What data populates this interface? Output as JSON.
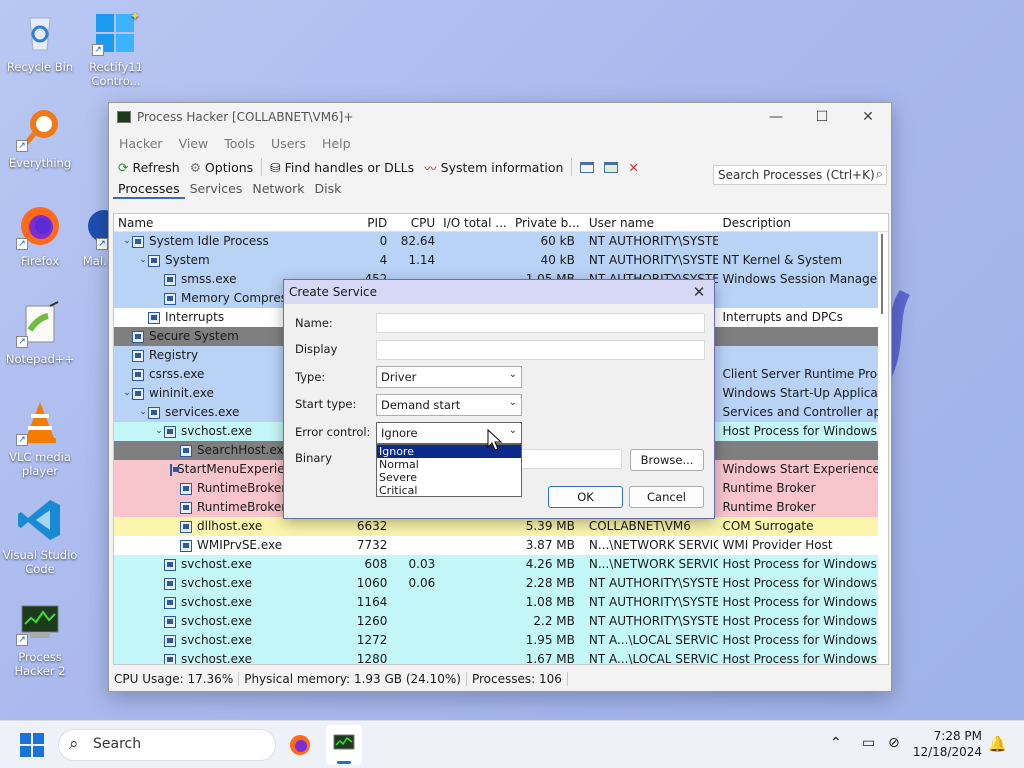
{
  "desktop": {
    "icons": [
      {
        "label": "Recycle Bin"
      },
      {
        "label": "Rectify11 Contro..."
      },
      {
        "label": "Everything"
      },
      {
        "label": "Firefox"
      },
      {
        "label": "Mal..."
      },
      {
        "label": "Notepad++"
      },
      {
        "label": "VLC media player"
      },
      {
        "label": "Visual Studio Code"
      },
      {
        "label": "Process Hacker 2"
      }
    ]
  },
  "window": {
    "title": "Process Hacker [COLLABNET\\VM6]+",
    "menu": [
      "Hacker",
      "View",
      "Tools",
      "Users",
      "Help"
    ],
    "toolbar": {
      "refresh": "Refresh",
      "options": "Options",
      "find": "Find handles or DLLs",
      "sysinfo": "System information"
    },
    "search_placeholder": "Search Processes (Ctrl+K)",
    "tabs": [
      "Processes",
      "Services",
      "Network",
      "Disk"
    ],
    "columns": [
      "Name",
      "PID",
      "CPU",
      "I/O total ...",
      "Private b...",
      "User name",
      "Description"
    ],
    "rows": [
      {
        "name": "System Idle Process",
        "pid": "0",
        "cpu": "82.64",
        "io": "",
        "priv": "60 kB",
        "user": "NT AUTHORITY\\SYSTEM",
        "desc": "",
        "indent": 0,
        "tw": "v",
        "color": "#b9d3f7"
      },
      {
        "name": "System",
        "pid": "4",
        "cpu": "1.14",
        "io": "",
        "priv": "40 kB",
        "user": "NT AUTHORITY\\SYSTEM",
        "desc": "NT Kernel & System",
        "indent": 1,
        "tw": "v",
        "color": "#b9d3f7"
      },
      {
        "name": "smss.exe",
        "pid": "452",
        "cpu": "",
        "io": "",
        "priv": "1.05 MB",
        "user": "NT AUTHORITY\\SYSTEM",
        "desc": "Windows Session Manager",
        "indent": 2,
        "tw": "",
        "color": "#b9d3f7"
      },
      {
        "name": "Memory Compression",
        "pid": "",
        "cpu": "",
        "io": "",
        "priv": "",
        "user": "",
        "desc": "",
        "indent": 2,
        "tw": "",
        "color": "#b9d3f7"
      },
      {
        "name": "Interrupts",
        "pid": "",
        "cpu": "",
        "io": "",
        "priv": "",
        "user": "",
        "desc": "Interrupts and DPCs",
        "indent": 1,
        "tw": "",
        "color": "#ffffff"
      },
      {
        "name": "Secure System",
        "pid": "",
        "cpu": "",
        "io": "",
        "priv": "",
        "user": "",
        "desc": "",
        "indent": 0,
        "tw": "",
        "color": "#7f7f7f"
      },
      {
        "name": "Registry",
        "pid": "",
        "cpu": "",
        "io": "",
        "priv": "",
        "user": "",
        "desc": "",
        "indent": 0,
        "tw": "",
        "color": "#b9d3f7"
      },
      {
        "name": "csrss.exe",
        "pid": "",
        "cpu": "",
        "io": "",
        "priv": "",
        "user": "",
        "desc": "Client Server Runtime Process",
        "indent": 0,
        "tw": "",
        "color": "#b9d3f7"
      },
      {
        "name": "wininit.exe",
        "pid": "",
        "cpu": "",
        "io": "",
        "priv": "",
        "user": "",
        "desc": "Windows Start-Up Application",
        "indent": 0,
        "tw": "v",
        "color": "#b9d3f7"
      },
      {
        "name": "services.exe",
        "pid": "",
        "cpu": "",
        "io": "",
        "priv": "",
        "user": "",
        "desc": "Services and Controller app",
        "indent": 1,
        "tw": "v",
        "color": "#b9d3f7"
      },
      {
        "name": "svchost.exe",
        "pid": "",
        "cpu": "",
        "io": "",
        "priv": "",
        "user": "",
        "desc": "Host Process for Windows Ser...",
        "indent": 2,
        "tw": "v",
        "color": "#c4f7f7"
      },
      {
        "name": "SearchHost.exe",
        "pid": "",
        "cpu": "",
        "io": "",
        "priv": "",
        "user": "",
        "desc": "",
        "indent": 3,
        "tw": "",
        "color": "#7f7f7f"
      },
      {
        "name": "StartMenuExperienceHost.exe",
        "pid": "",
        "cpu": "",
        "io": "",
        "priv": "",
        "user": "",
        "desc": "Windows Start Experience Host",
        "indent": 3,
        "tw": "",
        "color": "#f9c5cc"
      },
      {
        "name": "RuntimeBroker.exe",
        "pid": "",
        "cpu": "",
        "io": "",
        "priv": "",
        "user": "",
        "desc": "Runtime Broker",
        "indent": 3,
        "tw": "",
        "color": "#f9c5cc"
      },
      {
        "name": "RuntimeBroker.exe",
        "pid": "",
        "cpu": "",
        "io": "",
        "priv": "",
        "user": "",
        "desc": "Runtime Broker",
        "indent": 3,
        "tw": "",
        "color": "#f9c5cc"
      },
      {
        "name": "dllhost.exe",
        "pid": "6632",
        "cpu": "",
        "io": "",
        "priv": "5.39 MB",
        "user": "COLLABNET\\VM6",
        "desc": "COM Surrogate",
        "indent": 3,
        "tw": "",
        "color": "#fbf6ac"
      },
      {
        "name": "WMIPrvSE.exe",
        "pid": "7732",
        "cpu": "",
        "io": "",
        "priv": "3.87 MB",
        "user": "N...\\NETWORK SERVICE",
        "desc": "WMI Provider Host",
        "indent": 3,
        "tw": "",
        "color": "#ffffff"
      },
      {
        "name": "svchost.exe",
        "pid": "608",
        "cpu": "0.03",
        "io": "",
        "priv": "4.26 MB",
        "user": "N...\\NETWORK SERVICE",
        "desc": "Host Process for Windows Ser...",
        "indent": 2,
        "tw": "",
        "color": "#c4f7f7"
      },
      {
        "name": "svchost.exe",
        "pid": "1060",
        "cpu": "0.06",
        "io": "",
        "priv": "2.28 MB",
        "user": "NT AUTHORITY\\SYSTEM",
        "desc": "Host Process for Windows Ser...",
        "indent": 2,
        "tw": "",
        "color": "#c4f7f7"
      },
      {
        "name": "svchost.exe",
        "pid": "1164",
        "cpu": "",
        "io": "",
        "priv": "1.08 MB",
        "user": "NT AUTHORITY\\SYSTEM",
        "desc": "Host Process for Windows Ser...",
        "indent": 2,
        "tw": "",
        "color": "#c4f7f7"
      },
      {
        "name": "svchost.exe",
        "pid": "1260",
        "cpu": "",
        "io": "",
        "priv": "2.2 MB",
        "user": "NT AUTHORITY\\SYSTEM",
        "desc": "Host Process for Windows Ser...",
        "indent": 2,
        "tw": "",
        "color": "#c4f7f7"
      },
      {
        "name": "svchost.exe",
        "pid": "1272",
        "cpu": "",
        "io": "",
        "priv": "1.95 MB",
        "user": "NT A...\\LOCAL SERVICE",
        "desc": "Host Process for Windows Ser...",
        "indent": 2,
        "tw": "",
        "color": "#c4f7f7"
      },
      {
        "name": "svchost.exe",
        "pid": "1280",
        "cpu": "",
        "io": "",
        "priv": "1.67 MB",
        "user": "NT A...\\LOCAL SERVICE",
        "desc": "Host Process for Windows Ser...",
        "indent": 2,
        "tw": "",
        "color": "#c4f7f7"
      }
    ],
    "status": {
      "cpu": "CPU Usage: 17.36%",
      "mem": "Physical memory: 1.93 GB (24.10%)",
      "procs": "Processes: 106"
    }
  },
  "dialog": {
    "title": "Create Service",
    "name_label": "Name:",
    "display_label": "Display",
    "type_label": "Type:",
    "type_value": "Driver",
    "start_label": "Start type:",
    "start_value": "Demand start",
    "error_label": "Error control:",
    "error_value": "Ignore",
    "binary_label": "Binary",
    "browse": "Browse...",
    "ok": "OK",
    "cancel": "Cancel",
    "error_options": [
      "Ignore",
      "Normal",
      "Severe",
      "Critical"
    ]
  },
  "taskbar": {
    "search": "Search",
    "time": "7:28 PM",
    "date": "12/18/2024"
  }
}
